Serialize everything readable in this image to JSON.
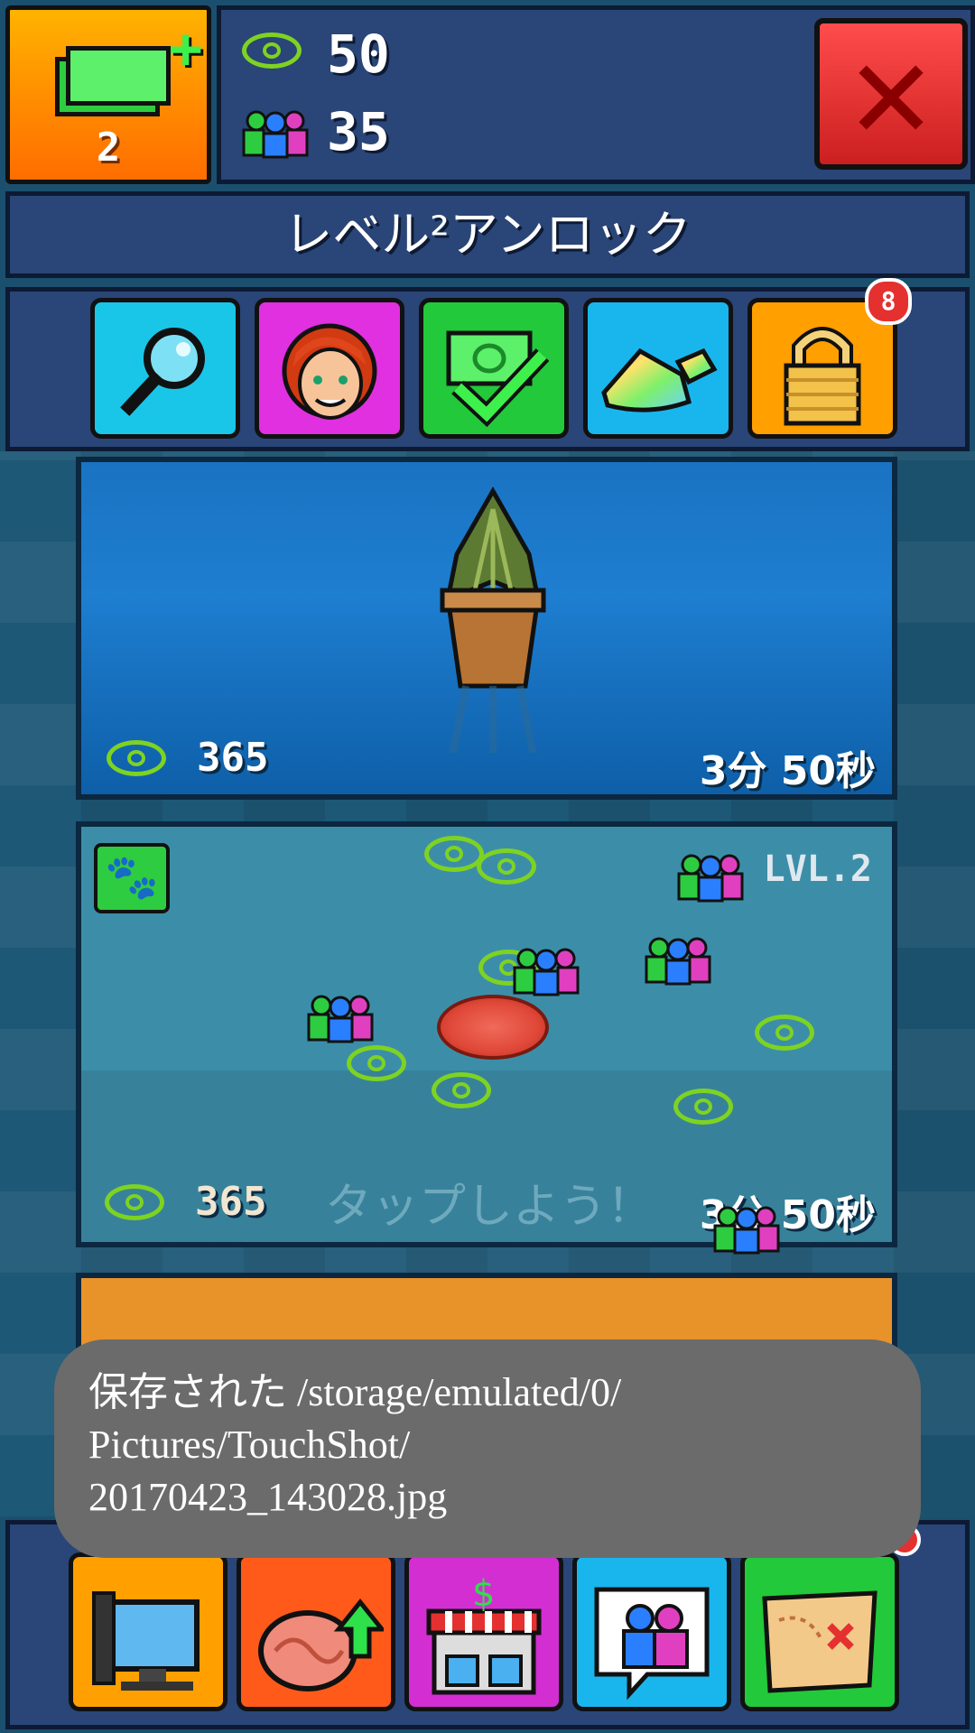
{
  "topbar": {
    "cash_count": "2",
    "followers": "50",
    "subscribers": "35"
  },
  "title": "レベル²アンロック",
  "tabs": [
    {
      "name": "search",
      "icon": "magnifier-icon",
      "color": "#19c6e8"
    },
    {
      "name": "character",
      "icon": "redhead-avatar-icon",
      "color": "#e030e0"
    },
    {
      "name": "cash-check",
      "icon": "money-check-icon",
      "color": "#22c93a"
    },
    {
      "name": "crystals",
      "icon": "rainbow-crystal-icon",
      "color": "#19b6ee"
    },
    {
      "name": "locked",
      "icon": "padlock-icon",
      "color": "#ff9f00",
      "badge": "8"
    }
  ],
  "card1": {
    "value": "365",
    "time": "3分 50秒",
    "item": "potted-plant-icon"
  },
  "card2": {
    "value": "365",
    "time": "3分 50秒",
    "level": "LVL.2",
    "tap_hint": "タップしよう！"
  },
  "toast": {
    "line1": "保存された /storage/emulated/0/",
    "line2": "Pictures/TouchShot/",
    "line3": "20170423_143028.jpg"
  },
  "bottom_nav": [
    {
      "name": "computer",
      "icon": "computer-icon",
      "color": "#ffa000"
    },
    {
      "name": "brain-upgrade",
      "icon": "brain-upgrade-icon",
      "color": "#ff5a1a"
    },
    {
      "name": "shop",
      "icon": "shop-icon",
      "color": "#d22ed2"
    },
    {
      "name": "social",
      "icon": "people-chat-icon",
      "color": "#19b6ee"
    },
    {
      "name": "map",
      "icon": "treasure-map-icon",
      "color": "#22c93a"
    }
  ]
}
